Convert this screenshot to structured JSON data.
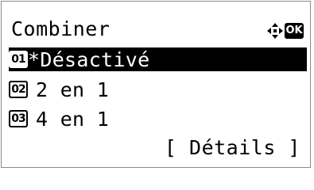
{
  "header": {
    "title": "Combiner",
    "nav_icon": "four-way-arrow-icon",
    "ok_label": "OK"
  },
  "menu": {
    "items": [
      {
        "number": "01",
        "label": "*Désactivé",
        "selected": true
      },
      {
        "number": "02",
        "label": "2 en 1",
        "selected": false
      },
      {
        "number": "03",
        "label": "4 en 1",
        "selected": false
      }
    ]
  },
  "footer": {
    "details_label": "[ Détails ]"
  },
  "colors": {
    "foreground": "#000000",
    "background": "#ffffff",
    "selected_bg": "#000000",
    "selected_fg": "#ffffff"
  }
}
